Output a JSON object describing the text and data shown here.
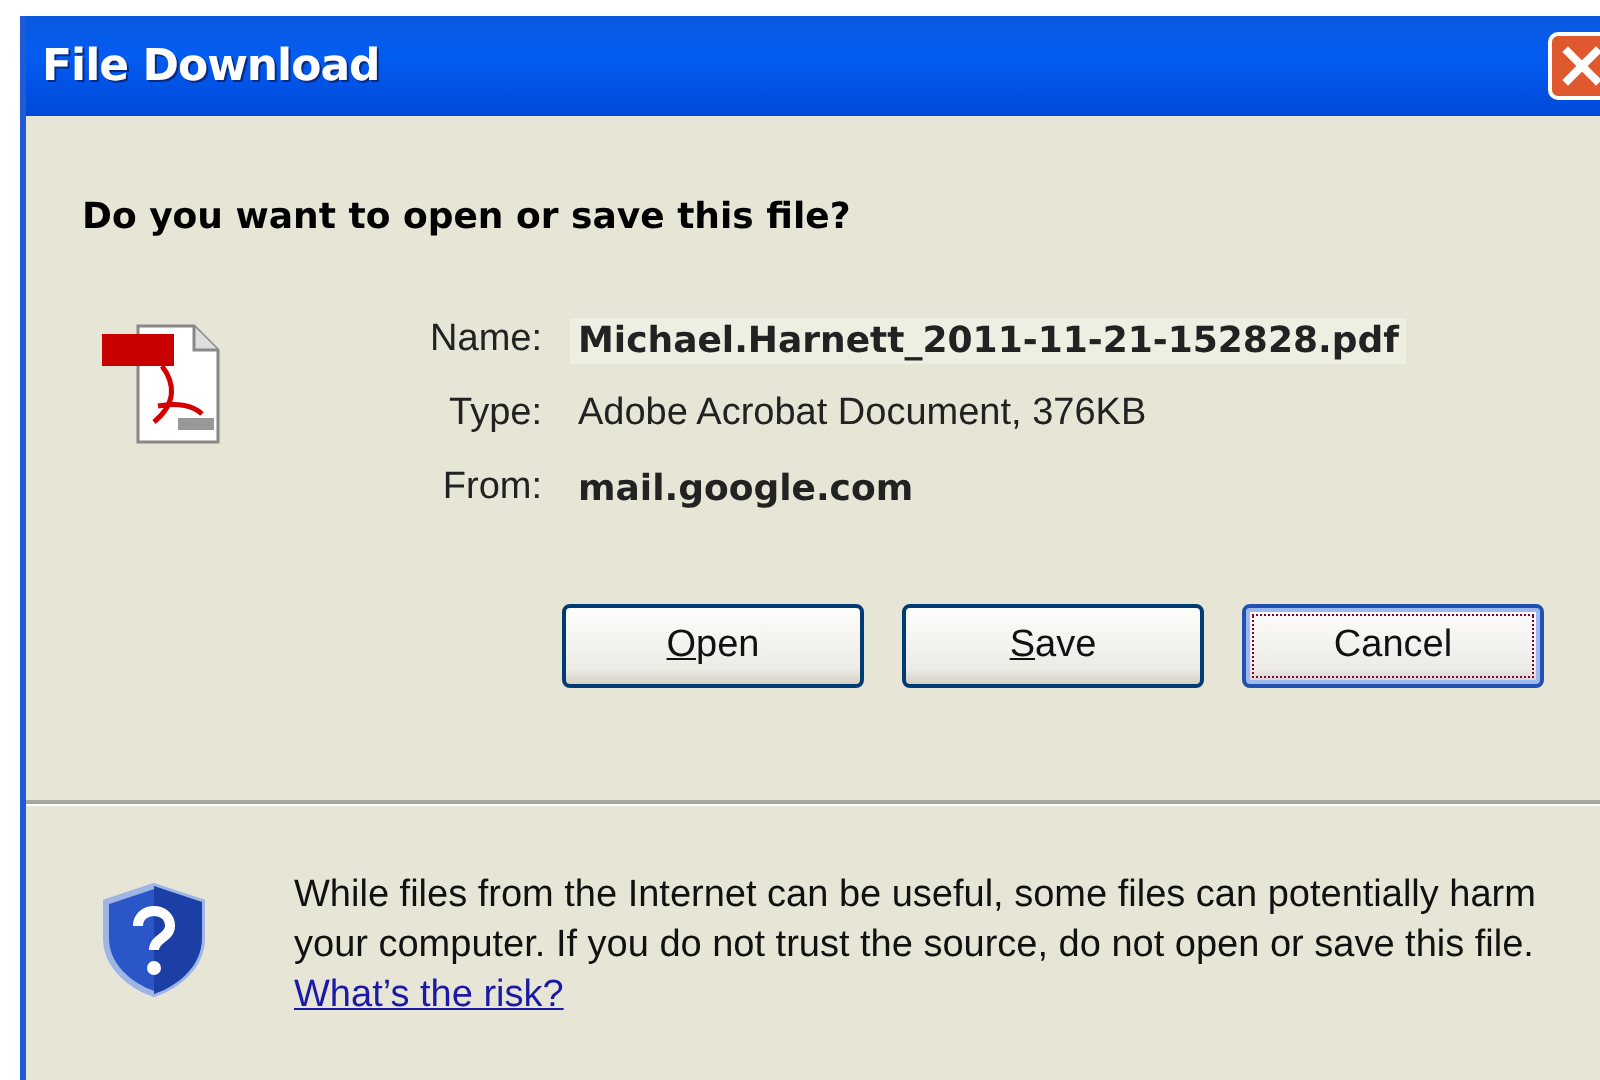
{
  "window": {
    "title": "File Download"
  },
  "question": "Do you want to open or save this file?",
  "file": {
    "fields": [
      {
        "label": "Name:",
        "value": "Michael.Harnett_2011-11-21-152828.pdf",
        "emphasis": true,
        "highlighted": true
      },
      {
        "label": "Type:",
        "value": "Adobe Acrobat Document, 376KB",
        "emphasis": false,
        "highlighted": false
      },
      {
        "label": "From:",
        "value": "mail.google.com",
        "emphasis": true,
        "highlighted": false
      }
    ]
  },
  "buttons": [
    {
      "access_key": "O",
      "rest": "pen",
      "focused": false
    },
    {
      "access_key": "S",
      "rest": "ave",
      "focused": false
    },
    {
      "rest": "Cancel",
      "focused": true
    }
  ],
  "warning": {
    "text": "While files from the Internet can be useful, some files can potentially harm your computer. If you do not trust the source, do not open or save this file.",
    "link": "What’s the risk?"
  }
}
